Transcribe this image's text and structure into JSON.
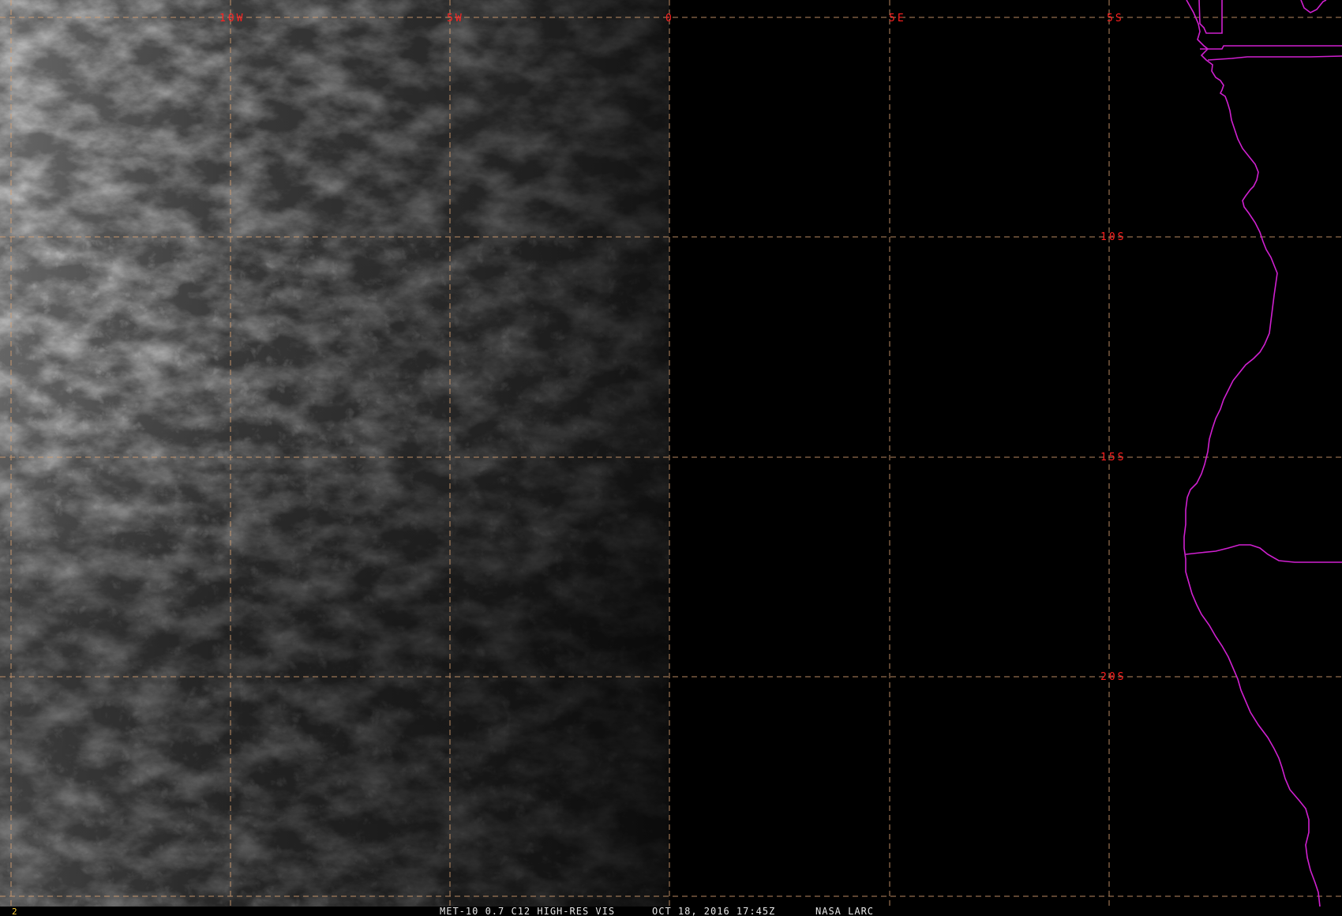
{
  "map": {
    "lon_labels": [
      "10W",
      "5W",
      "0",
      "5E",
      "5S"
    ],
    "lat_labels": [
      "10S",
      "15S",
      "20S"
    ],
    "caption": {
      "satellite": "MET-10 0.7 C12 HIGH-RES VIS",
      "datetime": "OCT 18, 2016 17:45Z",
      "source": "NASA LARC"
    },
    "frame_number": "2",
    "colors": {
      "gridline": "#d8a070",
      "label": "#ff2020",
      "coastline": "#d020d0",
      "caption": "#e8e8e8",
      "frame_number": "#ffd23c"
    }
  }
}
